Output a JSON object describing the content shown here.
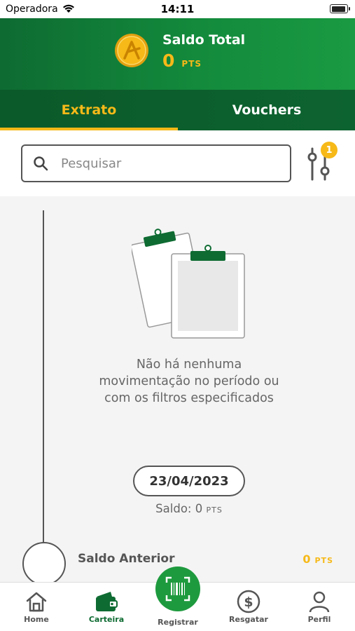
{
  "status_bar": {
    "carrier": "Operadora",
    "time": "14:11"
  },
  "header": {
    "balance_label": "Saldo Total",
    "balance_value": "0",
    "balance_unit": "PTS"
  },
  "tabs": [
    {
      "label": "Extrato",
      "active": true
    },
    {
      "label": "Vouchers",
      "active": false
    }
  ],
  "search": {
    "placeholder": "Pesquisar",
    "value": ""
  },
  "filter": {
    "badge_count": "1"
  },
  "empty_state": {
    "message": "Não há nenhuma movimentação no período ou com os filtros especificados"
  },
  "timeline": {
    "date": "23/04/2023",
    "saldo_label": "Saldo: 0",
    "saldo_unit": "PTS",
    "previous_label": "Saldo Anterior",
    "previous_value": "0",
    "previous_unit": "PTS"
  },
  "bottom_nav": [
    {
      "label": "Home",
      "icon": "home-icon"
    },
    {
      "label": "Carteira",
      "icon": "wallet-icon",
      "active": true
    },
    {
      "label": "Registrar",
      "icon": "barcode-scan-icon"
    },
    {
      "label": "Resgatar",
      "icon": "dollar-icon"
    },
    {
      "label": "Perfil",
      "icon": "user-icon"
    }
  ],
  "colors": {
    "primary_green": "#138a3c",
    "dark_green": "#0b5a29",
    "accent_yellow": "#f6b918"
  }
}
